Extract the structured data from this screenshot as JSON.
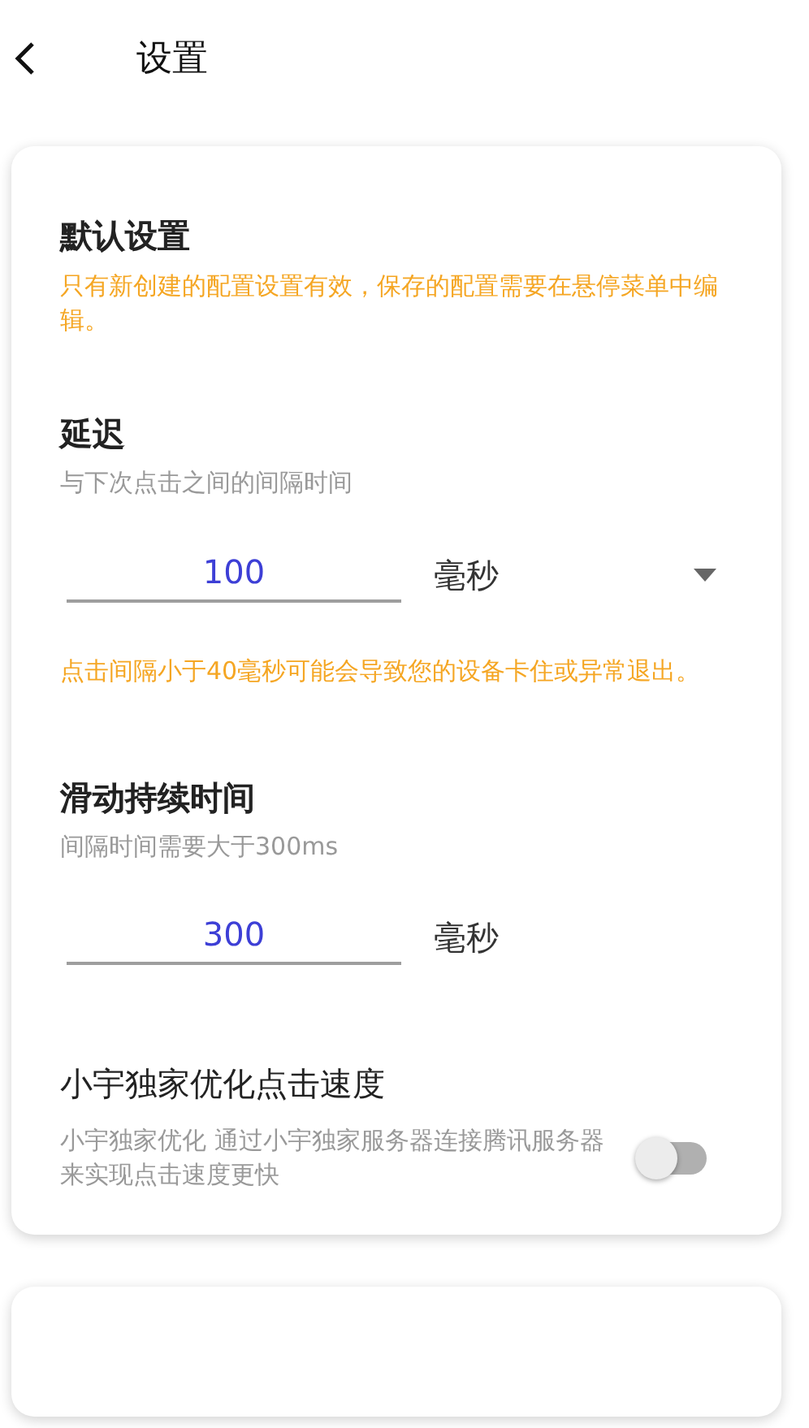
{
  "header": {
    "title": "设置"
  },
  "default_settings": {
    "title": "默认设置",
    "note": "只有新创建的配置设置有效，保存的配置需要在悬停菜单中编辑。"
  },
  "delay": {
    "title": "延迟",
    "subtitle": "与下次点击之间的间隔时间",
    "value": "100",
    "unit": "毫秒",
    "warning": "点击间隔小于40毫秒可能会导致您的设备卡住或异常退出。"
  },
  "swipe_duration": {
    "title": "滑动持续时间",
    "subtitle": "间隔时间需要大于300ms",
    "value": "300",
    "unit": "毫秒"
  },
  "speed_boost": {
    "title": "小宇独家优化点击速度",
    "description": "小宇独家优化 通过小宇独家服务器连接腾讯服务器来实现点击速度更快",
    "on": false
  }
}
